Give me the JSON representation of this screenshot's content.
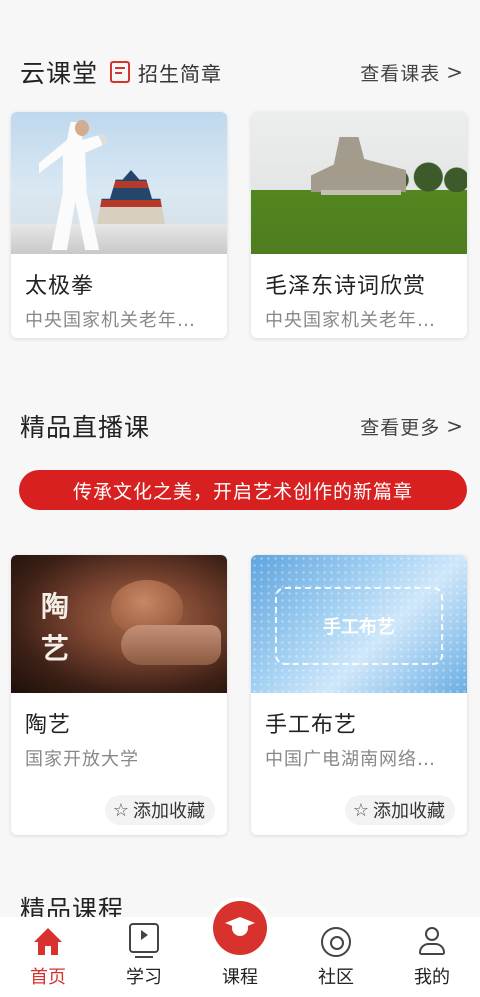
{
  "cloud_class": {
    "title": "云课堂",
    "admission_label": "招生简章",
    "more_label": "查看课表",
    "cards": [
      {
        "title": "太极拳",
        "subtitle": "中央国家机关老年…"
      },
      {
        "title": "毛泽东诗词欣赏",
        "subtitle": "中央国家机关老年…"
      }
    ]
  },
  "live": {
    "title": "精品直播课",
    "more_label": "查看更多",
    "banner": "传承文化之美，开启艺术创作的新篇章",
    "cards": [
      {
        "title": "陶艺",
        "subtitle": "国家开放大学",
        "thumb_text_1": "陶",
        "thumb_text_2": "艺",
        "fav_label": "添加收藏"
      },
      {
        "title": "手工布艺",
        "subtitle": "中国广电湖南网络…",
        "thumb_text": "手工布艺",
        "fav_label": "添加收藏"
      }
    ]
  },
  "featured": {
    "title": "精品课程"
  },
  "tabbar": {
    "items": [
      {
        "label": "首页",
        "icon": "home-icon",
        "active": true
      },
      {
        "label": "学习",
        "icon": "video-icon"
      },
      {
        "label": "课程",
        "icon": "graduation-cap-icon"
      },
      {
        "label": "社区",
        "icon": "community-icon"
      },
      {
        "label": "我的",
        "icon": "user-icon"
      }
    ]
  },
  "colors": {
    "accent": "#d8322f",
    "banner": "#d82020"
  }
}
